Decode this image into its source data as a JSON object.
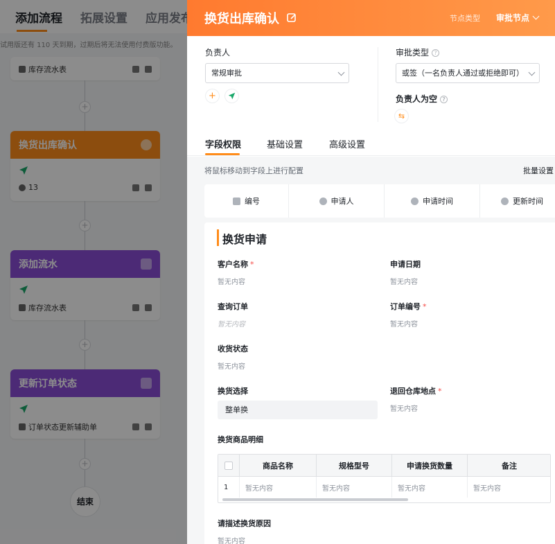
{
  "left": {
    "tabs": [
      "添加流程",
      "拓展设置",
      "应用发布"
    ],
    "trial_notice": "试用版还有 110 天到期，过期后将无法使用付费版功能。",
    "plus": "+",
    "top_node": {
      "item": "库存流水表"
    },
    "nodes": [
      {
        "title": "换货出库确认",
        "color": "#ff8c1a",
        "count": "13",
        "item": ""
      },
      {
        "title": "添加流水",
        "color": "#8a4dd8",
        "item": "库存流水表"
      },
      {
        "title": "更新订单状态",
        "color": "#8a4dd8",
        "item": "订单状态更新辅助单"
      }
    ],
    "end_label": "结束"
  },
  "drawer": {
    "title": "换货出库确认",
    "node_type_label": "节点类型",
    "node_type_value": "审批节点",
    "owner": {
      "label": "负责人",
      "value": "常规审批"
    },
    "approval_type": {
      "label": "审批类型",
      "value": "或签（一名负责人通过或拒绝即可）"
    },
    "empty_owner": {
      "label": "负责人为空"
    },
    "tabs": [
      "字段权限",
      "基础设置",
      "高级设置"
    ],
    "hint": "将鼠标移动到字段上进行配置",
    "batch": "批量设置",
    "system_fields": [
      "编号",
      "申请人",
      "申请时间",
      "更新时间"
    ],
    "section_title": "换货申请",
    "empty": "暂无内容",
    "fields": {
      "customer": "客户名称",
      "apply_date": "申请日期",
      "query_order": "查询订单",
      "order_no": "订单编号",
      "receive_status": "收货状态",
      "swap_choice": "换货选择",
      "swap_choice_value": "整单换",
      "return_warehouse": "退回仓库地点",
      "detail": "换货商品明细",
      "reason": "请描述换货原因"
    },
    "table": {
      "headers": [
        "商品名称",
        "规格型号",
        "申请换货数量",
        "备注"
      ],
      "row_no": "1"
    },
    "required_mark": "*",
    "collapse_icon": "chevron-down-icon"
  }
}
